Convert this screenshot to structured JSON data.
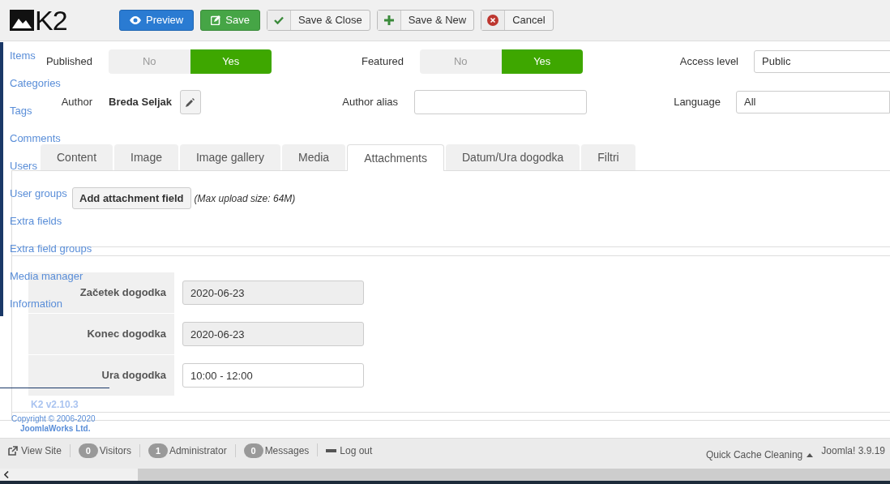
{
  "toolbar": {
    "logo": "K2",
    "buttons": [
      {
        "label": "Preview",
        "kind": "primary"
      },
      {
        "label": "Save",
        "kind": "success"
      },
      {
        "label": "Save & Close",
        "kind": "check"
      },
      {
        "label": "Save & New",
        "kind": "plus"
      },
      {
        "label": "Cancel",
        "kind": "cancel"
      }
    ]
  },
  "sidebar": {
    "items": [
      "Items",
      "Categories",
      "Tags",
      "Comments",
      "Users",
      "User groups",
      "Extra fields",
      "Extra field groups",
      "Media manager",
      "Information"
    ],
    "version": "K2 v2.10.3",
    "copyright": "Copyright © 2006-2020",
    "company": "JoomlaWorks Ltd."
  },
  "form": {
    "published": {
      "label": "Published",
      "options": [
        {
          "label": "No",
          "selected": false
        },
        {
          "label": "Yes",
          "selected": true
        }
      ]
    },
    "featured": {
      "label": "Featured",
      "options": [
        {
          "label": "No",
          "selected": false
        },
        {
          "label": "Yes",
          "selected": true
        }
      ]
    },
    "access_level": {
      "label": "Access level",
      "value": "Public"
    },
    "author": {
      "label": "Author",
      "value": "Breda Seljak"
    },
    "author_alias": {
      "label": "Author alias"
    },
    "language": {
      "label": "Language",
      "value": "All"
    }
  },
  "tabs": [
    {
      "label": "Content",
      "selected": false
    },
    {
      "label": "Image",
      "selected": false
    },
    {
      "label": "Image gallery",
      "selected": false
    },
    {
      "label": "Media",
      "selected": false
    },
    {
      "label": "Attachments",
      "selected": true
    },
    {
      "label": "Datum/Ura dogodka",
      "selected": false
    },
    {
      "label": "Filtri",
      "selected": false
    }
  ],
  "attachments": {
    "button": "Add attachment field",
    "note": "(Max upload size: 64M)"
  },
  "extra_fields": [
    {
      "label": "Začetek dogodka",
      "value": "2020-06-23",
      "disabled": true
    },
    {
      "label": "Konec dogodka",
      "value": "2020-06-23",
      "disabled": true
    },
    {
      "label": "Ura dogodka",
      "value": "10:00 - 12:00",
      "disabled": false
    }
  ],
  "status_bar": {
    "view_site": "View Site",
    "counters": [
      {
        "count": "0",
        "label": "Visitors"
      },
      {
        "count": "1",
        "label": "Administrator"
      },
      {
        "count": "0",
        "label": "Messages"
      }
    ],
    "log_out": "Log out",
    "quick_cache": "Quick Cache Cleaning",
    "version": "Joomla! 3.9.19"
  }
}
